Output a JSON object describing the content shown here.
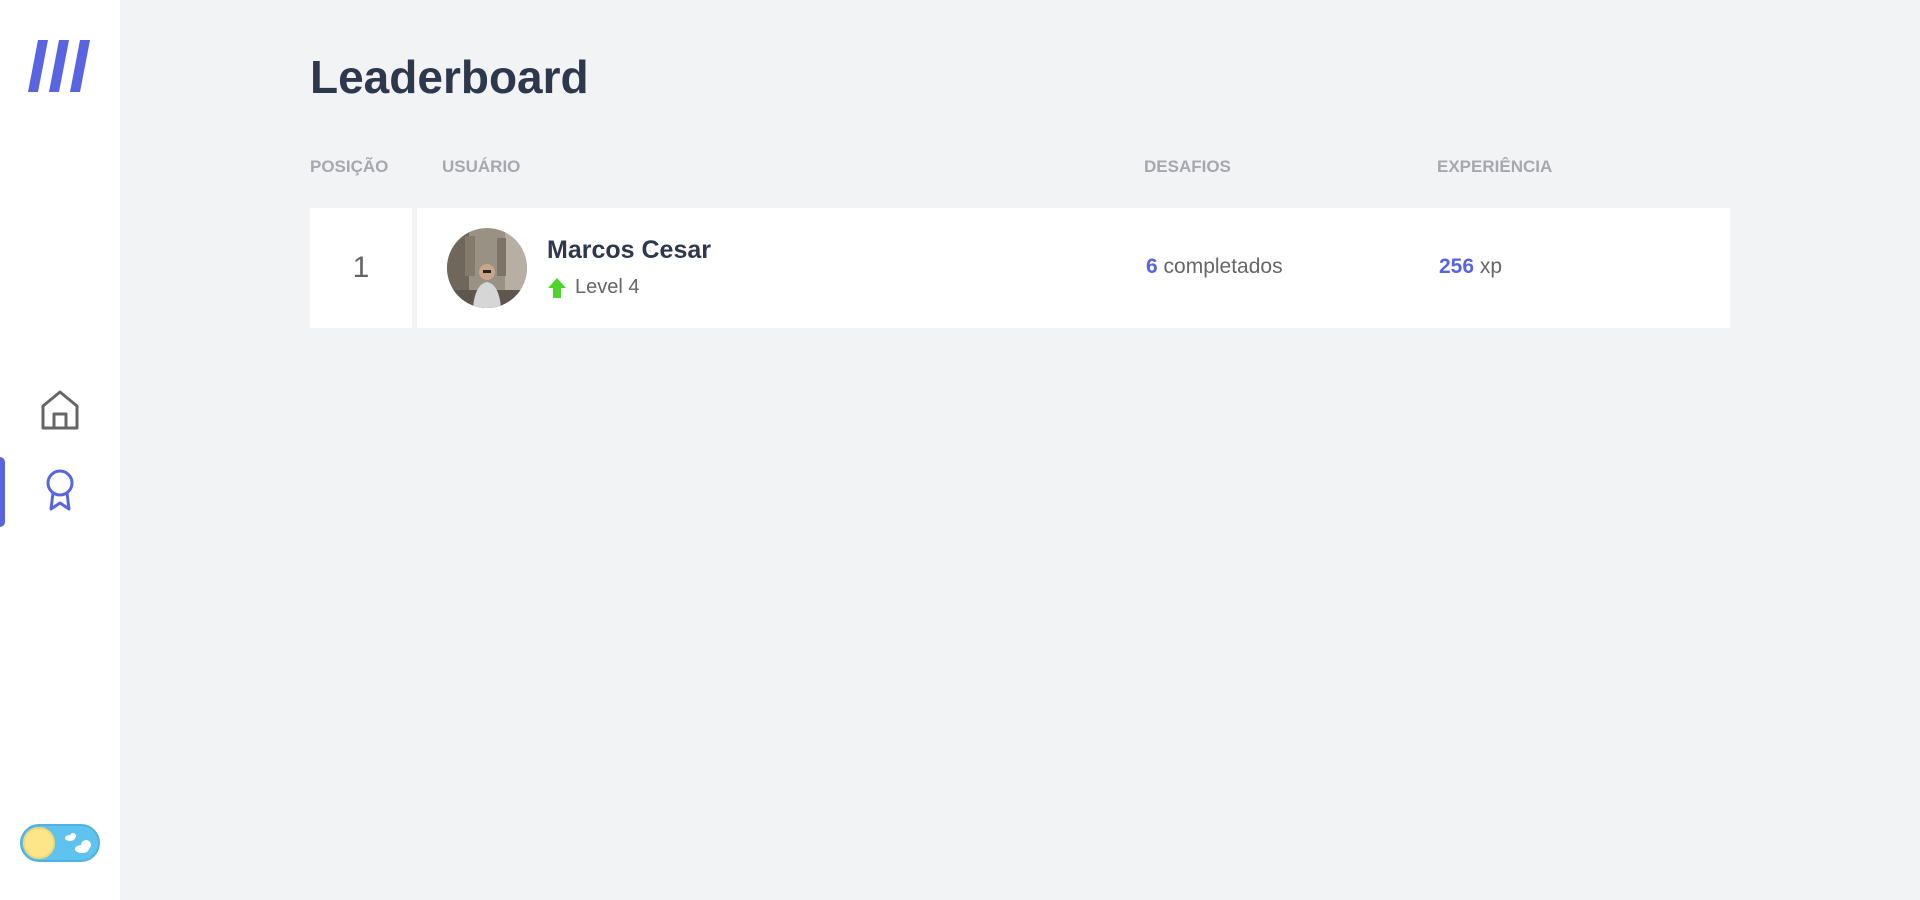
{
  "sidebar": {
    "logo_icon": "move-it-logo-icon",
    "items": [
      {
        "icon": "home-icon",
        "active": false
      },
      {
        "icon": "award-icon",
        "active": true
      }
    ],
    "theme_toggle": {
      "icon_on": "sun-icon",
      "icon_off": "cloud-icon",
      "mode": "light"
    }
  },
  "page": {
    "title": "Leaderboard"
  },
  "table": {
    "headers": {
      "position": "POSIÇÃO",
      "user": "USUÁRIO",
      "challenges": "DESAFIOS",
      "experience": "EXPERIÊNCIA"
    },
    "rows": [
      {
        "position": "1",
        "name": "Marcos Cesar",
        "level_label": "Level 4",
        "challenges_count": "6",
        "challenges_suffix": " completados",
        "xp_value": "256",
        "xp_suffix": " xp"
      }
    ]
  },
  "colors": {
    "accent": "#5965e0",
    "level_up": "#4cd62b",
    "background": "#f2f3f5",
    "title": "#2e384d"
  }
}
